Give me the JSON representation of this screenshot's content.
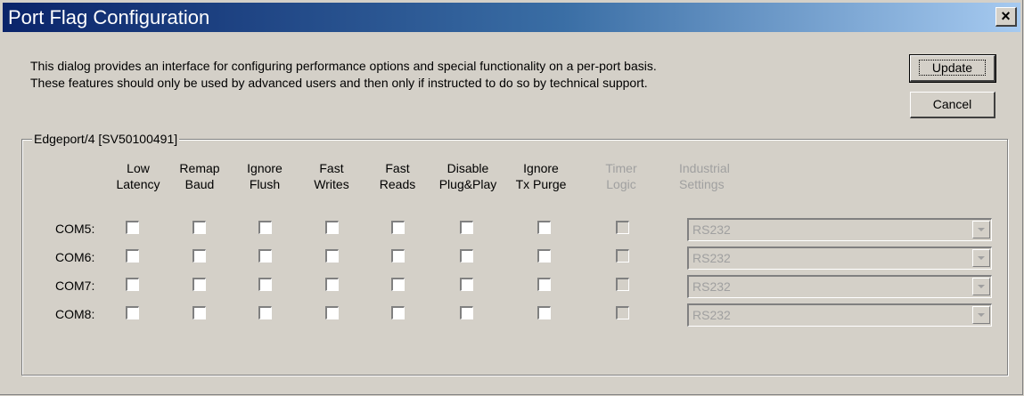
{
  "window": {
    "title": "Port Flag Configuration",
    "close_label": "×"
  },
  "description": {
    "line1": "This dialog provides an interface for configuring performance options and special functionality on a per-port basis.",
    "line2": "These features should only be used by advanced users and then only if instructed to do so by technical support."
  },
  "buttons": {
    "update": "Update",
    "cancel": "Cancel"
  },
  "group": {
    "label": "Edgeport/4 [SV50100491]"
  },
  "columns": [
    {
      "label": "Low\nLatency",
      "enabled": true
    },
    {
      "label": "Remap\nBaud",
      "enabled": true
    },
    {
      "label": "Ignore\nFlush",
      "enabled": true
    },
    {
      "label": "Fast\nWrites",
      "enabled": true
    },
    {
      "label": "Fast\nReads",
      "enabled": true
    },
    {
      "label": "Disable\nPlug&Play",
      "enabled": true
    },
    {
      "label": "Ignore\nTx Purge",
      "enabled": true
    },
    {
      "label": "Timer\nLogic",
      "enabled": false
    },
    {
      "label": "Industrial\nSettings",
      "enabled": false
    }
  ],
  "ports": [
    {
      "name": "COM5:",
      "industrial": "RS232"
    },
    {
      "name": "COM6:",
      "industrial": "RS232"
    },
    {
      "name": "COM7:",
      "industrial": "RS232"
    },
    {
      "name": "COM8:",
      "industrial": "RS232"
    }
  ]
}
